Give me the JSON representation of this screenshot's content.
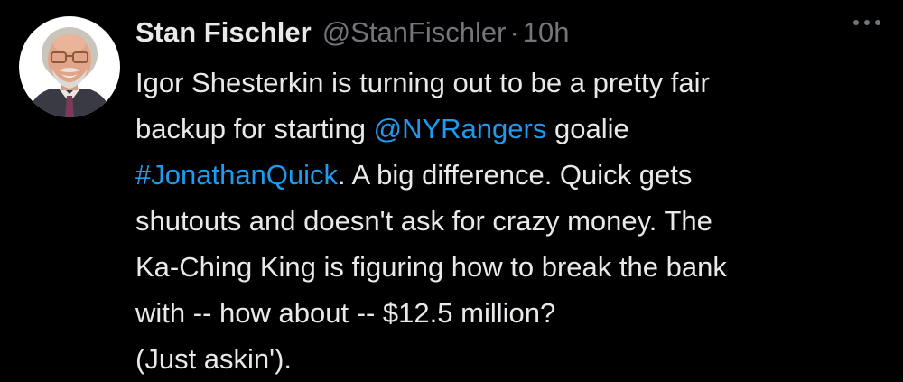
{
  "author": {
    "display_name": "Stan Fischler",
    "handle": "@StanFischler",
    "separator": "·",
    "time": "10h",
    "avatar_icon": "profile-photo"
  },
  "menu": {
    "icon": "more-options-icon"
  },
  "tweet": {
    "line1": "Igor Shesterkin is turning out to be a pretty fair",
    "line2_pre": "backup for starting ",
    "mention": "@NYRangers",
    "line2_post": " goalie",
    "hashtag": "#JonathanQuick",
    "line3_post": ". A big difference. Quick gets",
    "line4": "shutouts and doesn't ask for crazy money. The",
    "line5": "Ka-Ching King is figuring how to break the bank",
    "line6": "with -- how about -- $12.5 million?",
    "line7": "(Just askin')."
  },
  "colors": {
    "background": "#000000",
    "text": "#e7e9ea",
    "secondary": "#71767b",
    "link": "#1d9bf0"
  }
}
